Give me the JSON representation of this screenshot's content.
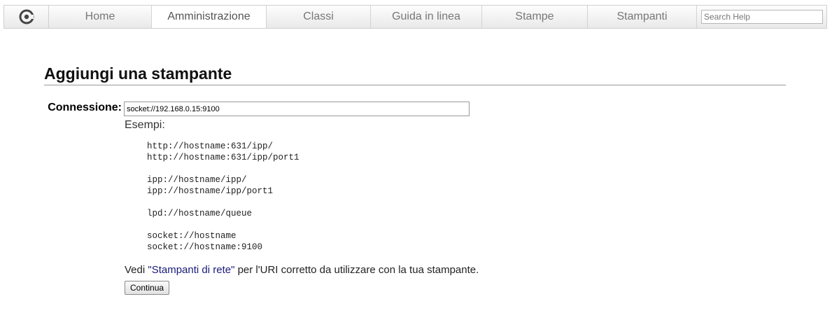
{
  "nav": {
    "tabs": [
      {
        "label": "Home",
        "active": false
      },
      {
        "label": "Amministrazione",
        "active": true
      },
      {
        "label": "Classi",
        "active": false
      },
      {
        "label": "Guida in linea",
        "active": false
      },
      {
        "label": "Stampe",
        "active": false
      },
      {
        "label": "Stampanti",
        "active": false
      }
    ],
    "search_placeholder": "Search Help",
    "logo_icon": "cups-logo-icon"
  },
  "page": {
    "title": "Aggiungi una stampante"
  },
  "form": {
    "connection_label": "Connessione:",
    "connection_value": "socket://192.168.0.15:9100",
    "examples_label": "Esempi:",
    "examples": [
      [
        "http://hostname:631/ipp/",
        "http://hostname:631/ipp/port1"
      ],
      [
        "ipp://hostname/ipp/",
        "ipp://hostname/ipp/port1"
      ],
      [
        "lpd://hostname/queue"
      ],
      [
        "socket://hostname",
        "socket://hostname:9100"
      ]
    ],
    "help_prefix": "Vedi ",
    "help_link": "\"Stampanti di rete\"",
    "help_suffix": " per l'URI corretto da utilizzare con la tua stampante.",
    "continue_label": "Continua"
  },
  "colors": {
    "link": "#1a1a7a",
    "active_tab_bg": "#ffffff",
    "tab_text": "#777777"
  }
}
